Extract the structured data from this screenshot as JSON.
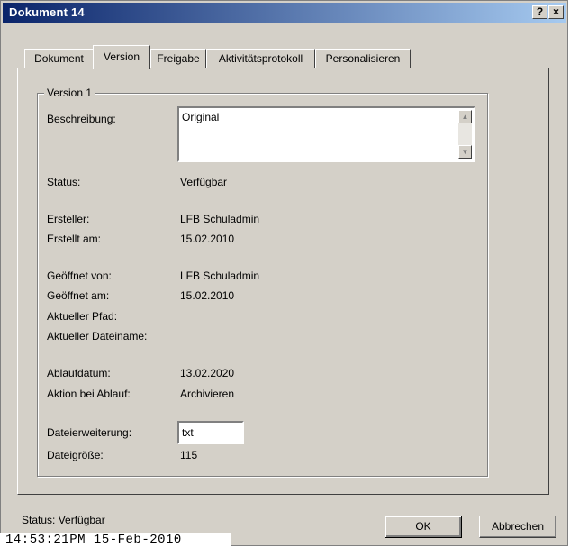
{
  "window": {
    "title": "Dokument 14",
    "help_label": "?",
    "close_label": "×"
  },
  "tabs": [
    {
      "label": "Dokument"
    },
    {
      "label": "Version"
    },
    {
      "label": "Freigabe"
    },
    {
      "label": "Aktivitätsprotokoll"
    },
    {
      "label": "Personalisieren"
    }
  ],
  "active_tab": "Version",
  "group": {
    "title": "Version 1"
  },
  "fields": {
    "beschreibung": {
      "label": "Beschreibung:",
      "value": "Original"
    },
    "status": {
      "label": "Status:",
      "value": "Verfügbar"
    },
    "ersteller": {
      "label": "Ersteller:",
      "value": "LFB Schuladmin"
    },
    "erstellt_am": {
      "label": "Erstellt am:",
      "value": "15.02.2010"
    },
    "geoeffnet_von": {
      "label": "Geöffnet von:",
      "value": "LFB Schuladmin"
    },
    "geoeffnet_am": {
      "label": "Geöffnet am:",
      "value": "15.02.2010"
    },
    "aktueller_pfad": {
      "label": "Aktueller Pfad:",
      "value": ""
    },
    "aktueller_dateiname": {
      "label": "Aktueller Dateiname:",
      "value": ""
    },
    "ablaufdatum": {
      "label": "Ablaufdatum:",
      "value": "13.02.2020"
    },
    "aktion_bei_ablauf": {
      "label": "Aktion bei Ablauf:",
      "value": "Archivieren"
    },
    "dateierweiterung": {
      "label": "Dateierweiterung:",
      "value": "txt"
    },
    "dateigroesse": {
      "label": "Dateigröße:",
      "value": "115"
    }
  },
  "statusbar": {
    "text": "Status: Verfügbar"
  },
  "buttons": {
    "ok": "OK",
    "cancel": "Abbrechen"
  },
  "timestamp": "14:53:21PM 15-Feb-2010",
  "icons": {
    "scroll_up": "scroll-up-arrow-icon",
    "scroll_down": "scroll-down-arrow-icon"
  },
  "colors": {
    "title_start": "#0a246a",
    "title_end": "#a6caf0",
    "face": "#d4d0c8"
  }
}
